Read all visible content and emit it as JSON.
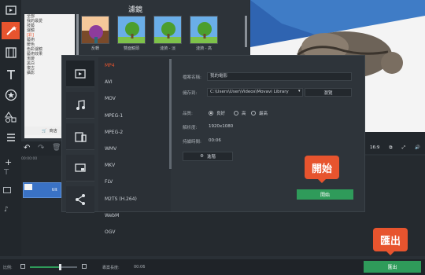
{
  "filters_panel": {
    "title": "濾鏡",
    "categories": [
      "全部",
      "我的最愛",
      "技藝",
      "濾鏡",
      "[彩]",
      "藝術",
      "暖色",
      "色彩濾鏡",
      "藝術效果",
      "漸變",
      "黑白",
      "復古",
      "攝影"
    ],
    "selected_index": 4,
    "store_label": "商店",
    "thumbnails": [
      {
        "label": "反轉",
        "icon": "inverted-tree-image"
      },
      {
        "label": "雙面鏡頭",
        "icon": "tree-image"
      },
      {
        "label": "漣漪 - 淡",
        "icon": "tree-image"
      },
      {
        "label": "漣漪 - 高",
        "icon": "tree-image"
      }
    ]
  },
  "dialog": {
    "formats": [
      "MP4",
      "AVI",
      "MOV",
      "MPEG-1",
      "MPEG-2",
      "WMV",
      "MKV",
      "FLV",
      "M2TS (H.264)",
      "WebM",
      "OGV"
    ],
    "selected_format": "MP4",
    "tabs": [
      "video-icon",
      "music-icon",
      "devices-icon",
      "screen-icon",
      "share-icon"
    ],
    "file_name_label": "檔案名稱:",
    "file_name_value": "我的電影",
    "save_to_label": "儲存到:",
    "save_to_value": "C:\\Users\\User\\Videos\\Movavi Library",
    "browse_label": "瀏覽",
    "quality_label": "品質:",
    "quality_options": [
      "良好",
      "高",
      "最高"
    ],
    "quality_selected": "良好",
    "resolution_label": "解析度:",
    "resolution_value": "1920x1080",
    "duration_label": "持續時間:",
    "duration_value": "00:06",
    "advanced_label": "進階",
    "start_button": "開始"
  },
  "callouts": {
    "start": "開始",
    "export": "匯出"
  },
  "timeline": {
    "ruler_start": "00:00:00",
    "ruler_next": "00:00:05",
    "clip_label": "tilt",
    "aspect_ratio": "16:9"
  },
  "statusbar": {
    "zoom_label": "比例:",
    "project_length_label": "專案長度:",
    "project_length_value": "00:06",
    "export_button": "匯出"
  },
  "colors": {
    "accent": "#e7542e",
    "action_green": "#2f9b5a",
    "background": "#2a3036"
  }
}
